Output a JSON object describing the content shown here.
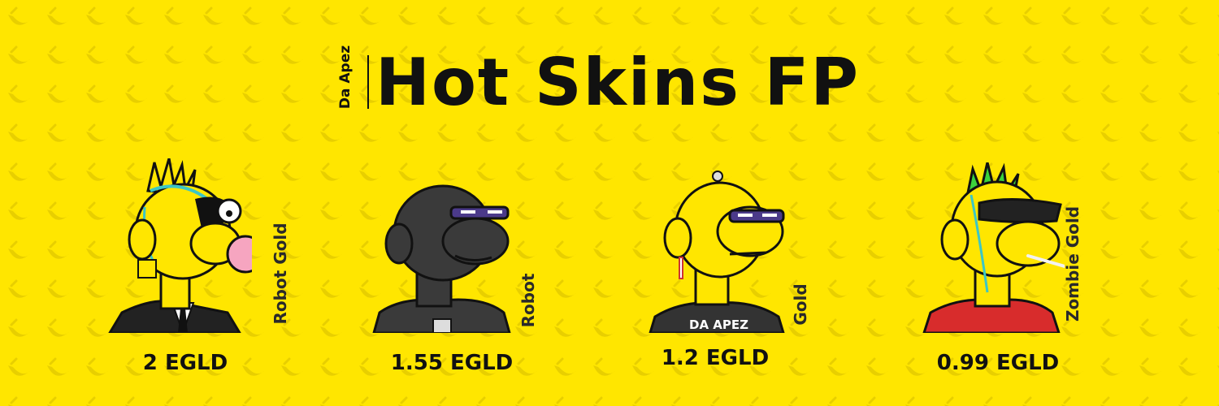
{
  "brand": "Da Apez",
  "title": "Hot Skins FP",
  "colors": {
    "background": "#FFE600",
    "pattern": "#E8CF00",
    "text": "#111111",
    "label": "#2a2a2a"
  },
  "background_pattern_icon": "banana-icon",
  "skins": [
    {
      "name": "Robot Gold",
      "price": "2 EGLD"
    },
    {
      "name": "Robot",
      "price": "1.55 EGLD"
    },
    {
      "name": "Gold",
      "price": "1.2 EGLD"
    },
    {
      "name": "Zombie Gold",
      "price": "0.99 EGLD"
    }
  ],
  "shirt_print": "DA APEZ"
}
